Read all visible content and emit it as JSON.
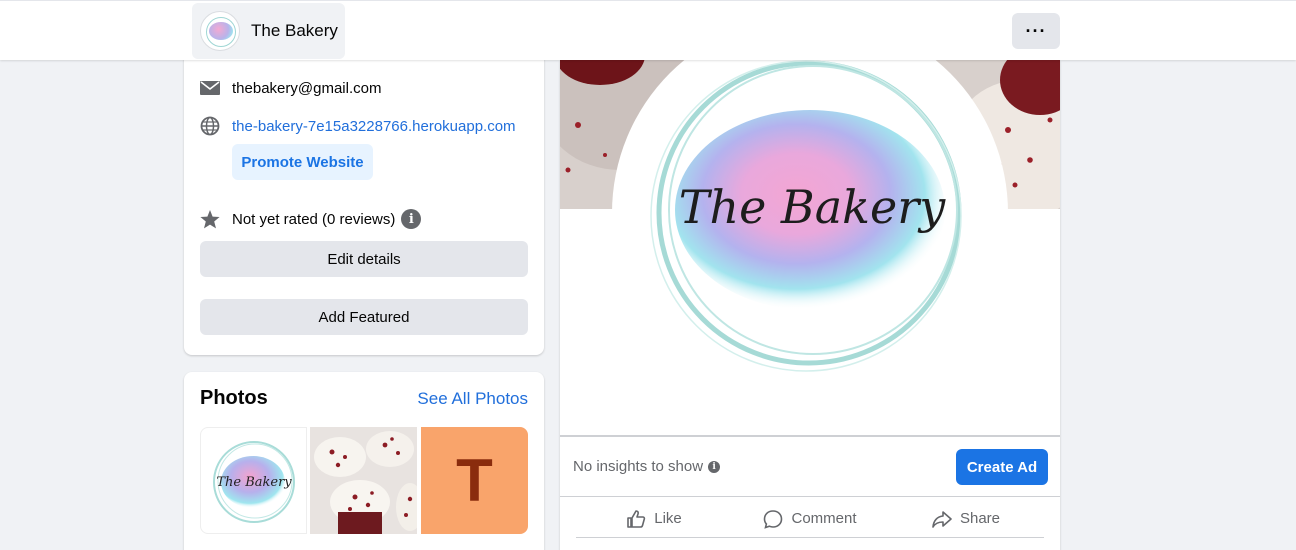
{
  "header": {
    "page_name": "The Bakery",
    "more_label": "···"
  },
  "intro": {
    "email": "thebakery@gmail.com",
    "website": "the-bakery-7e15a3228766.herokuapp.com",
    "promote_label": "Promote Website",
    "rating": "Not yet rated (0 reviews)",
    "info_glyph": "i",
    "edit_details_label": "Edit details",
    "add_featured_label": "Add Featured"
  },
  "photos": {
    "title": "Photos",
    "see_all_label": "See All Photos",
    "thumb3_letter": "T"
  },
  "main": {
    "logo_text": "The Bakery",
    "insights_text": "No insights to show",
    "create_ad_label": "Create Ad",
    "actions": [
      {
        "label": "Like",
        "icon": "like-icon"
      },
      {
        "label": "Comment",
        "icon": "comment-icon"
      },
      {
        "label": "Share",
        "icon": "share-icon"
      }
    ]
  },
  "colors": {
    "accent": "#1b74e4",
    "link": "#216fdb",
    "secondary_text": "#65676b",
    "button_gray": "#e4e6eb",
    "page_bg": "#f0f2f5"
  }
}
